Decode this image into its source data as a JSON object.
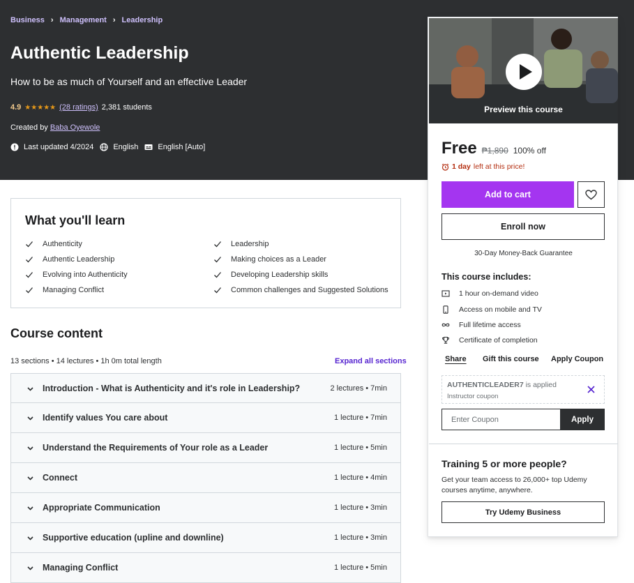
{
  "breadcrumb": [
    "Business",
    "Management",
    "Leadership"
  ],
  "course": {
    "title": "Authentic Leadership",
    "subtitle": "How to be as much of Yourself and an effective Leader",
    "rating": "4.9",
    "ratings_count": "(28 ratings)",
    "students": "2,381 students",
    "created_by_label": "Created by",
    "instructor": "Baba Oyewole",
    "last_updated": "Last updated 4/2024",
    "language": "English",
    "captions": "English [Auto]"
  },
  "learn": {
    "title": "What you'll learn",
    "left": [
      "Authenticity",
      "Authentic Leadership",
      "Evolving into Authenticity",
      "Managing Conflict"
    ],
    "right": [
      "Leadership",
      "Making choices as a Leader",
      "Developing Leadership skills",
      "Common challenges and Suggested Solutions"
    ]
  },
  "content": {
    "title": "Course content",
    "meta": "13 sections • 14 lectures • 1h 0m total length",
    "expand_label": "Expand all sections",
    "sections": [
      {
        "title": "Introduction - What is Authenticity and it's role in Leadership?",
        "info": "2 lectures • 7min"
      },
      {
        "title": "Identify values You care about",
        "info": "1 lecture • 7min"
      },
      {
        "title": "Understand the Requirements of Your role as a Leader",
        "info": "1 lecture • 5min"
      },
      {
        "title": "Connect",
        "info": "1 lecture • 4min"
      },
      {
        "title": "Appropriate Communication",
        "info": "1 lecture • 3min"
      },
      {
        "title": "Supportive education (upline and downline)",
        "info": "1 lecture • 3min"
      },
      {
        "title": "Managing Conflict",
        "info": "1 lecture • 5min"
      }
    ]
  },
  "card": {
    "preview_label": "Preview this course",
    "price": "Free",
    "old_price": "₱1,890",
    "discount": "100% off",
    "timer_bold": "1 day",
    "timer_rest": "left at this price!",
    "add_to_cart": "Add to cart",
    "enroll": "Enroll now",
    "guarantee": "30-Day Money-Back Guarantee",
    "includes_title": "This course includes:",
    "includes": [
      {
        "icon": "video-icon",
        "label": "1 hour on-demand video"
      },
      {
        "icon": "mobile-icon",
        "label": "Access on mobile and TV"
      },
      {
        "icon": "infinity-icon",
        "label": "Full lifetime access"
      },
      {
        "icon": "trophy-icon",
        "label": "Certificate of completion"
      }
    ],
    "share": "Share",
    "gift": "Gift this course",
    "apply_coupon": "Apply Coupon",
    "coupon_code": "AUTHENTICLEADER7",
    "coupon_applied": "is applied",
    "coupon_sub": "Instructor coupon",
    "coupon_placeholder": "Enter Coupon",
    "coupon_apply": "Apply",
    "team_title": "Training 5 or more people?",
    "team_text": "Get your team access to 26,000+ top Udemy courses anytime, anywhere.",
    "business_btn": "Try Udemy Business"
  },
  "colors": {
    "hero_bg": "#2d2f31",
    "accent_purple": "#a435f0",
    "link_purple": "#5624d0",
    "star": "#e59819",
    "urgency": "#b32d0f"
  }
}
